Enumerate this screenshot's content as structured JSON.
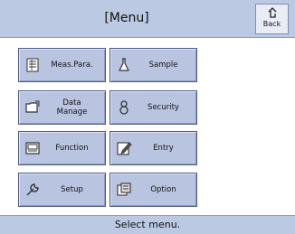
{
  "header": {
    "title": "[Menu]",
    "back_label": "Back",
    "back_icon": "return-arrow-icon"
  },
  "menu": {
    "items": [
      {
        "label": "Meas.Para.",
        "icon": "measurement-parameters-icon"
      },
      {
        "label": "Sample",
        "icon": "flask-icon"
      },
      {
        "label": "Data\nManage",
        "icon": "folder-icon"
      },
      {
        "label": "Security",
        "icon": "person-icon"
      },
      {
        "label": "Function",
        "icon": "function-icon"
      },
      {
        "label": "Entry",
        "icon": "edit-icon"
      },
      {
        "label": "Setup",
        "icon": "wrench-icon"
      },
      {
        "label": "Option",
        "icon": "option-icon"
      }
    ]
  },
  "status": {
    "text": "Select menu."
  },
  "colors": {
    "header_bg": "#bcc9e3",
    "tile_bg": "#b9c4e1",
    "tile_border": "#4d5a86",
    "background": "#ffffff"
  }
}
